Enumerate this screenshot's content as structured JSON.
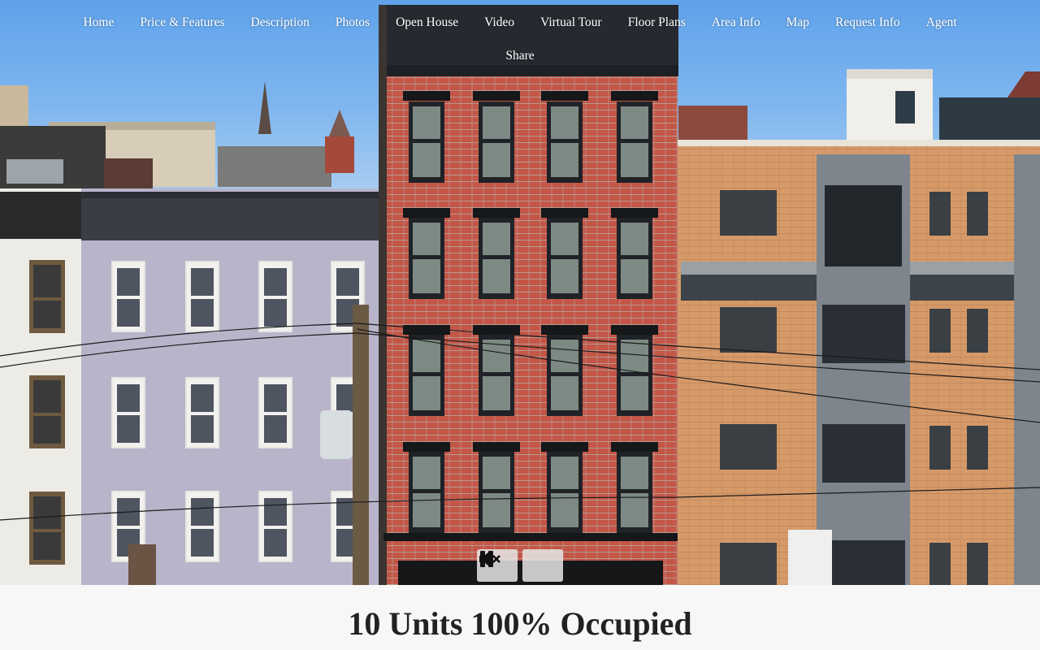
{
  "nav": {
    "items": [
      {
        "label": "Home"
      },
      {
        "label": "Price & Features"
      },
      {
        "label": "Description"
      },
      {
        "label": "Photos"
      },
      {
        "label": "Open House"
      },
      {
        "label": "Video"
      },
      {
        "label": "Virtual Tour"
      },
      {
        "label": "Floor Plans"
      },
      {
        "label": "Area Info"
      },
      {
        "label": "Map"
      },
      {
        "label": "Request Info"
      },
      {
        "label": "Agent"
      }
    ],
    "share_label": "Share"
  },
  "video_controls": {
    "mute_icon": "speaker-muted-icon",
    "pause_icon": "pause-icon"
  },
  "headline": "10 Units 100% Occupied",
  "colors": {
    "nav_text": "#ffffff",
    "sky": "#6aa8ec",
    "brick_red": "#c4584a",
    "brick_tan": "#d59a6a",
    "lavender": "#b9b5cc"
  }
}
